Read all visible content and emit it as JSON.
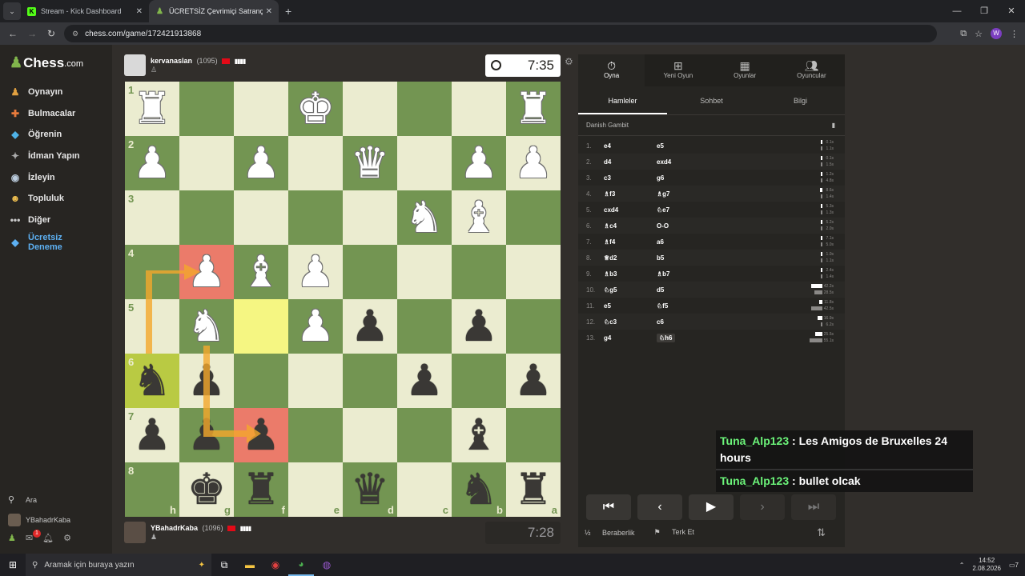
{
  "browser": {
    "tabs": [
      {
        "title": "Stream - Kick Dashboard",
        "favicon": "K"
      },
      {
        "title": "ÜCRETSİZ Çevrimiçi Satranç Oy…",
        "favicon": "♟"
      }
    ],
    "url": "chess.com/game/172421913868",
    "profile_initial": "W"
  },
  "sidebar": {
    "logo": "Chess",
    "logo_suffix": ".com",
    "items": [
      {
        "label": "Oynayın",
        "icon": "play-icon"
      },
      {
        "label": "Bulmacalar",
        "icon": "puzzle-icon"
      },
      {
        "label": "Öğrenin",
        "icon": "learn-icon"
      },
      {
        "label": "İdman Yapın",
        "icon": "train-icon"
      },
      {
        "label": "İzleyin",
        "icon": "watch-icon"
      },
      {
        "label": "Topluluk",
        "icon": "community-icon"
      },
      {
        "label": "Diğer",
        "icon": "more-icon"
      }
    ],
    "trial": "Ücretsiz Deneme",
    "search_label": "Ara",
    "username": "YBahadrKaba",
    "notifications": "1"
  },
  "top_player": {
    "name": "kervanaslan",
    "rating": "(1095)",
    "clock": "7:35"
  },
  "bottom_player": {
    "name": "YBahadrKaba",
    "rating": "(1096)",
    "clock": "7:28"
  },
  "board": {
    "ranks": [
      "1",
      "2",
      "3",
      "4",
      "5",
      "6",
      "7",
      "8"
    ],
    "files": [
      "h",
      "g",
      "f",
      "e",
      "d",
      "c",
      "b",
      "a"
    ],
    "pieces": [
      {
        "sq": "a1",
        "p": "wR"
      },
      {
        "sq": "e1",
        "p": "wK"
      },
      {
        "sq": "h1",
        "p": "wR"
      },
      {
        "sq": "a2",
        "p": "wP"
      },
      {
        "sq": "b2",
        "p": "wP"
      },
      {
        "sq": "d2",
        "p": "wQ"
      },
      {
        "sq": "f2",
        "p": "wP"
      },
      {
        "sq": "h2",
        "p": "wP"
      },
      {
        "sq": "b3",
        "p": "wB"
      },
      {
        "sq": "c3",
        "p": "wN"
      },
      {
        "sq": "e4",
        "p": "wP"
      },
      {
        "sq": "f4",
        "p": "wB"
      },
      {
        "sq": "g4",
        "p": "wP"
      },
      {
        "sq": "e5",
        "p": "wP"
      },
      {
        "sq": "g5",
        "p": "wN"
      },
      {
        "sq": "d5",
        "p": "bP"
      },
      {
        "sq": "b5",
        "p": "bP"
      },
      {
        "sq": "h6",
        "p": "bN"
      },
      {
        "sq": "g6",
        "p": "bP"
      },
      {
        "sq": "c6",
        "p": "bP"
      },
      {
        "sq": "a6",
        "p": "bP"
      },
      {
        "sq": "h7",
        "p": "bP"
      },
      {
        "sq": "g7",
        "p": "bP"
      },
      {
        "sq": "f7",
        "p": "bP"
      },
      {
        "sq": "b7",
        "p": "bB"
      },
      {
        "sq": "g8",
        "p": "bK"
      },
      {
        "sq": "f8",
        "p": "bR"
      },
      {
        "sq": "d8",
        "p": "bQ"
      },
      {
        "sq": "b8",
        "p": "bN"
      },
      {
        "sq": "a8",
        "p": "bR"
      }
    ],
    "highlights": [
      {
        "sq": "g4",
        "c": "red"
      },
      {
        "sq": "f7",
        "c": "red"
      },
      {
        "sq": "f5",
        "c": "yellow"
      },
      {
        "sq": "h6",
        "c": "lime"
      }
    ]
  },
  "panel": {
    "tabs": [
      {
        "label": "Oyna",
        "icon": "stopwatch-icon"
      },
      {
        "label": "Yeni Oyun",
        "icon": "plus-icon"
      },
      {
        "label": "Oyunlar",
        "icon": "board-icon"
      },
      {
        "label": "Oyuncular",
        "icon": "players-icon"
      }
    ],
    "subtabs": [
      "Hamleler",
      "Sohbet",
      "Bilgi"
    ],
    "opening": "Danish Gambit",
    "moves": [
      {
        "n": "1.",
        "w": "e4",
        "b": "e5",
        "tw": "0.1s",
        "tb": "1.1s",
        "fw": 0.03,
        "fb": 0.02
      },
      {
        "n": "2.",
        "w": "d4",
        "b": "exd4",
        "tw": "0.1s",
        "tb": "1.5s",
        "fw": 0.03,
        "fb": 0.03
      },
      {
        "n": "3.",
        "w": "c3",
        "b": "g6",
        "tw": "1.2s",
        "tb": "4.8s",
        "fw": 0.04,
        "fb": 0.1
      },
      {
        "n": "4.",
        "w": "♗f3",
        "b": "♗g7",
        "tw": "8.6s",
        "tb": "1.4s",
        "fw": 0.18,
        "fb": 0.03
      },
      {
        "n": "5.",
        "w": "cxd4",
        "b": "♘e7",
        "tw": "5.3s",
        "tb": "1.3s",
        "fw": 0.11,
        "fb": 0.03
      },
      {
        "n": "6.",
        "w": "♗c4",
        "b": "O-O",
        "tw": "5.2s",
        "tb": "2.0s",
        "fw": 0.11,
        "fb": 0.04
      },
      {
        "n": "7.",
        "w": "♗f4",
        "b": "a6",
        "tw": "7.1s",
        "tb": "5.0s",
        "fw": 0.15,
        "fb": 0.1
      },
      {
        "n": "8.",
        "w": "♕d2",
        "b": "b5",
        "tw": "1.0s",
        "tb": "1.1s",
        "fw": 0.02,
        "fb": 0.02
      },
      {
        "n": "9.",
        "w": "♗b3",
        "b": "♗b7",
        "tw": "2.4s",
        "tb": "1.4s",
        "fw": 0.05,
        "fb": 0.03
      },
      {
        "n": "10.",
        "w": "♘g5",
        "b": "d5",
        "tw": "42.2s",
        "tb": "28.5s",
        "fw": 0.9,
        "fb": 0.6
      },
      {
        "n": "11.",
        "w": "e5",
        "b": "♘f5",
        "tw": "11.8s",
        "tb": "42.5s",
        "fw": 0.25,
        "fb": 0.9
      },
      {
        "n": "12.",
        "w": "♘c3",
        "b": "c6",
        "tw": "16.9s",
        "tb": "6.2s",
        "fw": 0.36,
        "fb": 0.13
      },
      {
        "n": "13.",
        "w": "g4",
        "b": "♘h6",
        "tw": "25.5s",
        "tb": "55.1s",
        "fw": 0.54,
        "fb": 1.0
      }
    ],
    "draw_label": "Beraberlik",
    "resign_label": "Terk Et"
  },
  "chat": [
    {
      "user": "Tuna_Alp123",
      "text": "Les Amigos de Bruxelles 24 hours"
    },
    {
      "user": "Tuna_Alp123",
      "text": "bullet olcak"
    }
  ],
  "taskbar": {
    "search_placeholder": "Aramak için buraya yazın",
    "time": "14:52",
    "date": "2.08.2026",
    "notif_count": "7"
  },
  "colors": {
    "light_square": "#ebecd0",
    "dark_square": "#739552",
    "accent_green": "#81b64c",
    "chat_user": "#6cf57a"
  }
}
